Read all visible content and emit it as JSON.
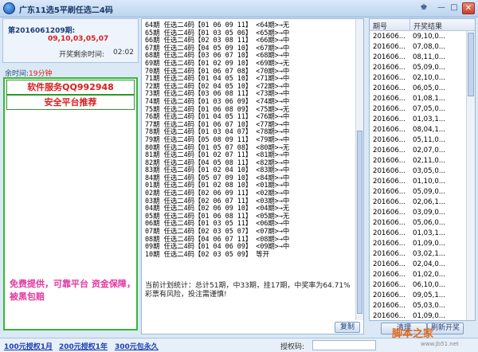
{
  "window": {
    "title": "广东11选5平刷任选二4码"
  },
  "info": {
    "issue": "第2016061209期:",
    "numbers": "09,10,03,05,07",
    "countdown_label": "开奖剩余时间:",
    "countdown_value": "02:02",
    "remain_label": "余时间:",
    "remain_value": "19分钟"
  },
  "ads": {
    "service": "软件服务QQ992948",
    "platform": "安全平台推荐",
    "promo": "免费提供，可靠平台 资金保障，被黑包赔"
  },
  "results": [
    "64期 任选二4码【01 06 09 11】 <64期>→无",
    "65期 任选二4码【01 03 05 06】 <65期>→中",
    "66期 任选二4码【02 03 08 11】 <66期>→中",
    "67期 任选二4码【04 05 09 10】 <67期>→中",
    "68期 任选二4码【03 06 07 10】 <68期>→中",
    "69期 任选二4码【01 02 09 10】 <69期>→无",
    "70期 任选二4码【01 06 07 08】 <70期>→中",
    "71期 任选二4码【01 04 05 10】 <71期>→中",
    "72期 任选二4码【02 04 05 10】 <72期>→中",
    "73期 任选二4码【03 06 08 11】 <73期>→中",
    "74期 任选二4码【01 03 06 09】 <74期>→中",
    "75期 任选二4码【01 06 08 09】 <75期>→无",
    "76期 任选二4码【01 04 05 11】 <76期>→中",
    "77期 任选二4码【01 06 07 10】 <77期>→中",
    "78期 任选二4码【01 03 04 07】 <78期>→中",
    "79期 任选二4码【05 08 09 11】 <79期>→中",
    "80期 任选二4码【01 05 07 08】 <80期>→无",
    "81期 任选二4码【01 02 07 11】 <81期>→中",
    "82期 任选二4码【04 05 08 11】 <82期>→中",
    "83期 任选二4码【01 02 04 10】 <83期>→中",
    "84期 任选二4码【05 07 09 10】 <84期>→中",
    "01期 任选二4码【01 02 08 10】 <01期>→中",
    "02期 任选二4码【02 06 09 11】 <02期>→中",
    "03期 任选二4码【02 06 07 11】 <03期>→中",
    "04期 任选二4码【02 06 09 10】 <04期>→无",
    "05期 任选二4码【01 06 08 11】 <05期>→无",
    "06期 任选二4码【01 03 05 11】 <06期>→中",
    "07期 任选二4码【02 03 05 07】 <07期>→中",
    "08期 任选二4码【04 06 07 11】 <08期>→中",
    "09期 任选二4码【01 04 06 09】 <09期>→中",
    "10期 任选二4码【02 03 05 09】 等开"
  ],
  "stats": {
    "line1": "当前计划统计：总计51期，中33期，挂17期，中奖率为64.71%",
    "line2": "彩票有风险，投注需谨慎!"
  },
  "buttons": {
    "copy": "复制",
    "clear": "清理",
    "refresh": "刷新开奖"
  },
  "history": {
    "col_period": "期号",
    "col_result": "开奖结果",
    "rows": [
      {
        "period": "201606...",
        "result": "09,10,0..."
      },
      {
        "period": "201606...",
        "result": "07,08,0..."
      },
      {
        "period": "201606...",
        "result": "08,11,0..."
      },
      {
        "period": "201606...",
        "result": "05,09,0..."
      },
      {
        "period": "201606...",
        "result": "02,10,0..."
      },
      {
        "period": "201606...",
        "result": "06,05,0..."
      },
      {
        "period": "201606...",
        "result": "01,08,1..."
      },
      {
        "period": "201606...",
        "result": "07,05,0..."
      },
      {
        "period": "201606...",
        "result": "01,03,1..."
      },
      {
        "period": "201606...",
        "result": "08,04,1..."
      },
      {
        "period": "201606...",
        "result": "05,11,0..."
      },
      {
        "period": "201606...",
        "result": "02,07,0..."
      },
      {
        "period": "201606...",
        "result": "02,11,0..."
      },
      {
        "period": "201606...",
        "result": "03,05,0..."
      },
      {
        "period": "201606...",
        "result": "01,10,0..."
      },
      {
        "period": "201606...",
        "result": "05,09,0..."
      },
      {
        "period": "201606...",
        "result": "02,06,1..."
      },
      {
        "period": "201606...",
        "result": "03,09,0..."
      },
      {
        "period": "201606...",
        "result": "05,06,0..."
      },
      {
        "period": "201606...",
        "result": "01,03,1..."
      },
      {
        "period": "201606...",
        "result": "01,09,0..."
      },
      {
        "period": "201606...",
        "result": "03,02,1..."
      },
      {
        "period": "201606...",
        "result": "02,04,0..."
      },
      {
        "period": "201606...",
        "result": "01,02,0..."
      },
      {
        "period": "201606...",
        "result": "06,10,0..."
      },
      {
        "period": "201606...",
        "result": "09,05,1..."
      },
      {
        "period": "201606...",
        "result": "05,03,0..."
      },
      {
        "period": "201606...",
        "result": "01,09,0..."
      }
    ]
  },
  "footer": {
    "link1": "100元授权1月",
    "link2": "200元授权1年",
    "link3": "300元包永久",
    "auth_label": "授权码:",
    "watermark": "脚本之家",
    "watermark_sub": "www.jb51.net"
  }
}
